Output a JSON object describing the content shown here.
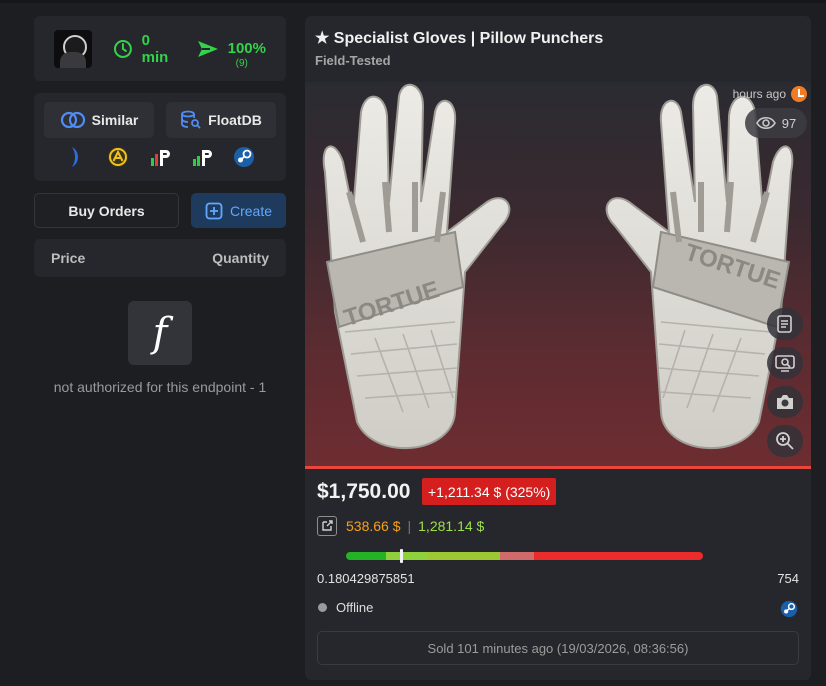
{
  "seller": {
    "avatar_icon": "anime-avatar",
    "response_time": "0 min",
    "success_rate": "100%",
    "trade_count": "(9)"
  },
  "tools": {
    "similar_label": "Similar",
    "floatdb_label": "FloatDB",
    "market_icons": [
      "buff-icon",
      "csfloat-a-icon",
      "pricempire-icon",
      "pricempire-alt-icon",
      "steam-icon"
    ]
  },
  "buy_orders": {
    "label": "Buy Orders",
    "create_label": "Create",
    "price_header": "Price",
    "quantity_header": "Quantity",
    "error_icon": "f",
    "error_text": "not authorized for this endpoint - 1"
  },
  "item": {
    "title": "★ Specialist Gloves | Pillow Punchers",
    "wear": "Field-Tested",
    "time_ago": "hours ago",
    "views": "97",
    "glove_text": "TORTUE",
    "price": "$1,750.00",
    "price_delta": "+1,211.34 $ (325%)",
    "ref_price_1": "538.66 $",
    "ref_sep": "|",
    "ref_price_2": "1,281.14 $",
    "float_value": "0.180429875851",
    "float_marker": 0.1804,
    "pattern": "754",
    "status": "Offline",
    "sold_text": "Sold 101 minutes ago (19/03/2026, 08:36:56)"
  },
  "colors": {
    "accent_green": "#33d24b",
    "delta_red": "#d51f1f",
    "create_blue": "#62a8ff",
    "ref_orange": "#f5a11c",
    "ref_green": "#9ee04b"
  }
}
